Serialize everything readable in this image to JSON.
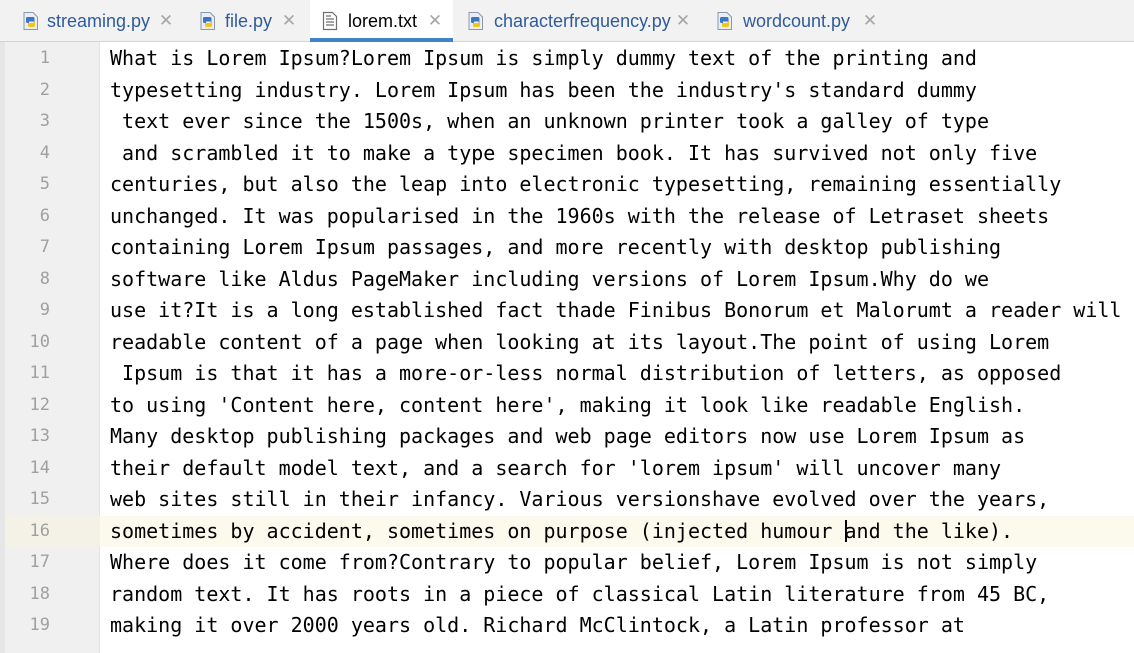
{
  "tabs": [
    {
      "label": "streaming.py",
      "type": "python",
      "active": false
    },
    {
      "label": "file.py",
      "type": "python",
      "active": false
    },
    {
      "label": "lorem.txt",
      "type": "text",
      "active": true
    },
    {
      "label": "characterfrequency.py",
      "type": "python",
      "active": false
    },
    {
      "label": "wordcount.py",
      "type": "python",
      "active": false
    }
  ],
  "close_glyph": "✕",
  "editor": {
    "caret_line": 16,
    "lines": [
      {
        "num": "1",
        "text": "What is Lorem Ipsum?Lorem Ipsum is simply dummy text of the printing and"
      },
      {
        "num": "2",
        "text": "typesetting industry. Lorem Ipsum has been the industry's standard dummy"
      },
      {
        "num": "3",
        "text": " text ever since the 1500s, when an unknown printer took a galley of type"
      },
      {
        "num": "4",
        "text": " and scrambled it to make a type specimen book. It has survived not only five"
      },
      {
        "num": "5",
        "text": "centuries, but also the leap into electronic typesetting, remaining essentially"
      },
      {
        "num": "6",
        "text": "unchanged. It was popularised in the 1960s with the release of Letraset sheets"
      },
      {
        "num": "7",
        "text": "containing Lorem Ipsum passages, and more recently with desktop publishing"
      },
      {
        "num": "8",
        "text": "software like Aldus PageMaker including versions of Lorem Ipsum.Why do we"
      },
      {
        "num": "9",
        "text": "use it?It is a long established fact thade Finibus Bonorum et Malorumt a reader will b"
      },
      {
        "num": "10",
        "text": "readable content of a page when looking at its layout.The point of using Lorem"
      },
      {
        "num": "11",
        "text": " Ipsum is that it has a more-or-less normal distribution of letters, as opposed"
      },
      {
        "num": "12",
        "text": "to using 'Content here, content here', making it look like readable English."
      },
      {
        "num": "13",
        "text": "Many desktop publishing packages and web page editors now use Lorem Ipsum as"
      },
      {
        "num": "14",
        "text": "their default model text, and a search for 'lorem ipsum' will uncover many"
      },
      {
        "num": "15",
        "text": "web sites still in their infancy. Various versionshave evolved over the years,"
      },
      {
        "num": "16",
        "text_before_caret": "sometimes by accident, sometimes on purpose (injected humour ",
        "text_after_caret": "and the like)."
      },
      {
        "num": "17",
        "text": "Where does it come from?Contrary to popular belief, Lorem Ipsum is not simply"
      },
      {
        "num": "18",
        "text": "random text. It has roots in a piece of classical Latin literature from 45 BC,"
      },
      {
        "num": "19",
        "text": "making it over 2000 years old. Richard McClintock, a Latin professor at"
      }
    ]
  },
  "colors": {
    "tab_active_underline": "#4083c9",
    "tab_inactive_text": "#2f5b9c",
    "caret_line_bg": "#fcfaed",
    "line_number": "#a0a0a0"
  }
}
